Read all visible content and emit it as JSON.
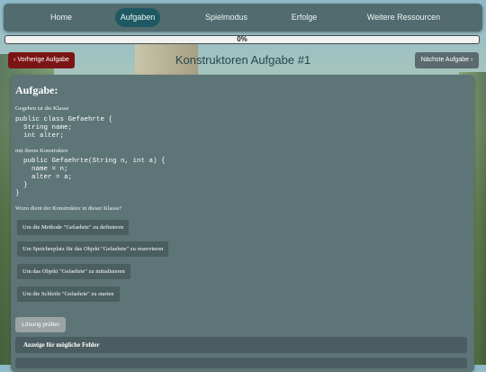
{
  "nav": {
    "items": [
      {
        "label": "Home"
      },
      {
        "label": "Aufgaben",
        "active": true
      },
      {
        "label": "Spielmodus"
      },
      {
        "label": "Erfolge"
      },
      {
        "label": "Weitere Ressourcen"
      }
    ]
  },
  "progress": {
    "value": 0,
    "text": "0%"
  },
  "toolbar": {
    "prev_label": "Vorherige Aufgabe",
    "next_label": "Nächste Aufgabe",
    "title": "Konstruktoren Aufgabe #1"
  },
  "task": {
    "heading": "Aufgabe:",
    "intro": "Gegeben ist die Klasse",
    "code1": "public class Gefaehrte {\n  String name;\n  int alter;",
    "middle": "mit ihrem Konstruktor",
    "code2": "  public Gefaehrte(String n, int a) {\n    name = n;\n    alter = a;\n  }\n}",
    "question": "Wozu dient der Konstruktor in dieser Klasse?",
    "options": [
      "Um die Methode \"Gefaehrte\" zu definieren",
      "Um Speicherplatz für das Objekt \"Gefaehrte\" zu reservieren",
      "Um das Objekt \"Gefaehrte\" zu initialisieren",
      "Um die Schleife \"Gefaehrte\" zu starten"
    ],
    "check_label": "Lösung prüfen",
    "error_panel_label": "Anzeige für mögliche Fehler"
  },
  "colors": {
    "nav_bg": "#516b6f",
    "nav_active": "#1e5963",
    "prev_button": "#7b1515",
    "card_bg": "#5d7576"
  },
  "icons": {
    "prev": "chevron-left-icon",
    "next": "chevron-right-icon"
  }
}
